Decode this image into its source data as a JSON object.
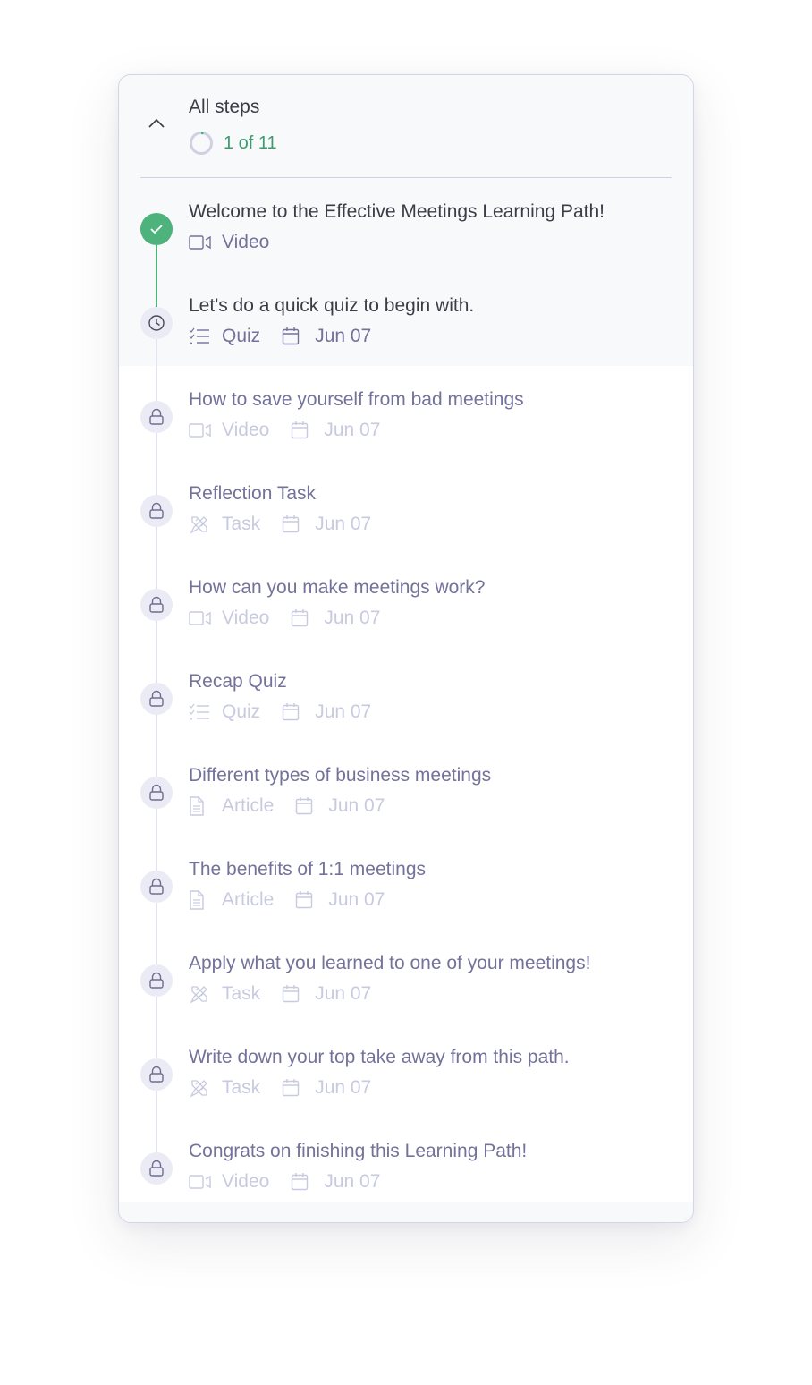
{
  "header": {
    "title": "All steps",
    "progress_text": "1 of 11",
    "progress": {
      "completed": 1,
      "total": 11
    },
    "collapse_icon": "chevron-up-icon"
  },
  "colors": {
    "success": "#4db27c",
    "progress_text": "#3f9b6e",
    "title_active": "#3c3c46",
    "title_locked": "#73729a",
    "meta_locked": "#c8cadf",
    "border": "#d3d5e6"
  },
  "steps": [
    {
      "title": "Welcome to the Effective Meetings Learning Path!",
      "type": "Video",
      "type_icon": "video-icon",
      "date": "",
      "status": "completed",
      "status_icon": "check-icon"
    },
    {
      "title": "Let's do a quick quiz to begin with.",
      "type": "Quiz",
      "type_icon": "checklist-icon",
      "date": "Jun 07",
      "status": "current",
      "status_icon": "clock-icon"
    },
    {
      "title": "How to save yourself from bad meetings",
      "type": "Video",
      "type_icon": "video-icon",
      "date": "Jun 07",
      "status": "locked",
      "status_icon": "lock-icon"
    },
    {
      "title": "Reflection Task",
      "type": "Task",
      "type_icon": "tools-icon",
      "date": "Jun 07",
      "status": "locked",
      "status_icon": "lock-icon"
    },
    {
      "title": "How can you make meetings work?",
      "type": "Video",
      "type_icon": "video-icon",
      "date": "Jun 07",
      "status": "locked",
      "status_icon": "lock-icon"
    },
    {
      "title": "Recap Quiz",
      "type": "Quiz",
      "type_icon": "checklist-icon",
      "date": "Jun 07",
      "status": "locked",
      "status_icon": "lock-icon"
    },
    {
      "title": "Different types of business meetings",
      "type": "Article",
      "type_icon": "document-icon",
      "date": "Jun 07",
      "status": "locked",
      "status_icon": "lock-icon"
    },
    {
      "title": "The benefits of 1:1 meetings",
      "type": "Article",
      "type_icon": "document-icon",
      "date": "Jun 07",
      "status": "locked",
      "status_icon": "lock-icon"
    },
    {
      "title": "Apply what you learned to one of your meetings!",
      "type": "Task",
      "type_icon": "tools-icon",
      "date": "Jun 07",
      "status": "locked",
      "status_icon": "lock-icon"
    },
    {
      "title": "Write down your top take away from this path.",
      "type": "Task",
      "type_icon": "tools-icon",
      "date": "Jun 07",
      "status": "locked",
      "status_icon": "lock-icon"
    },
    {
      "title": "Congrats on finishing this Learning Path!",
      "type": "Video",
      "type_icon": "video-icon",
      "date": "Jun 07",
      "status": "locked",
      "status_icon": "lock-icon"
    }
  ]
}
